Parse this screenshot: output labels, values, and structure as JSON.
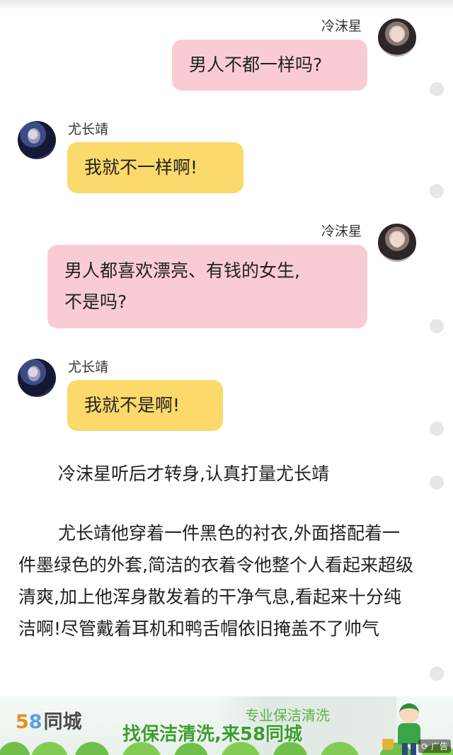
{
  "messages": [
    {
      "speaker": "冷沫星",
      "side": "right",
      "text": "男人不都一样吗?"
    },
    {
      "speaker": "尤长靖",
      "side": "left",
      "text": "我就不一样啊!"
    },
    {
      "speaker": "冷沫星",
      "side": "right",
      "text": "男人都喜欢漂亮、有钱的女生,",
      "text2": "不是吗?"
    },
    {
      "speaker": "尤长靖",
      "side": "left",
      "text": "我就不是啊!"
    }
  ],
  "narration": {
    "line1": "冷沫星听后才转身,认真打量尤长靖",
    "para2": "尤长靖他穿着一件黑色的衬衣,外面搭配着一件墨绿色的外套,简洁的衣着令他整个人看起来超级清爽,加上他浑身散发着的干净气息,看起来十分纯洁啊!尽管戴着耳机和鸭舌帽依旧掩盖不了帅气"
  },
  "ad": {
    "logo_num_5": "5",
    "logo_num_8": "8",
    "logo_text": "同城",
    "subtitle": "专业保洁清洗",
    "headline": "找保洁清洗,来58同城",
    "tag": "广告"
  },
  "colors": {
    "right_bubble": "#f9ccd5",
    "left_bubble": "#fbd96a",
    "ad_green": "#3a9e2f"
  }
}
